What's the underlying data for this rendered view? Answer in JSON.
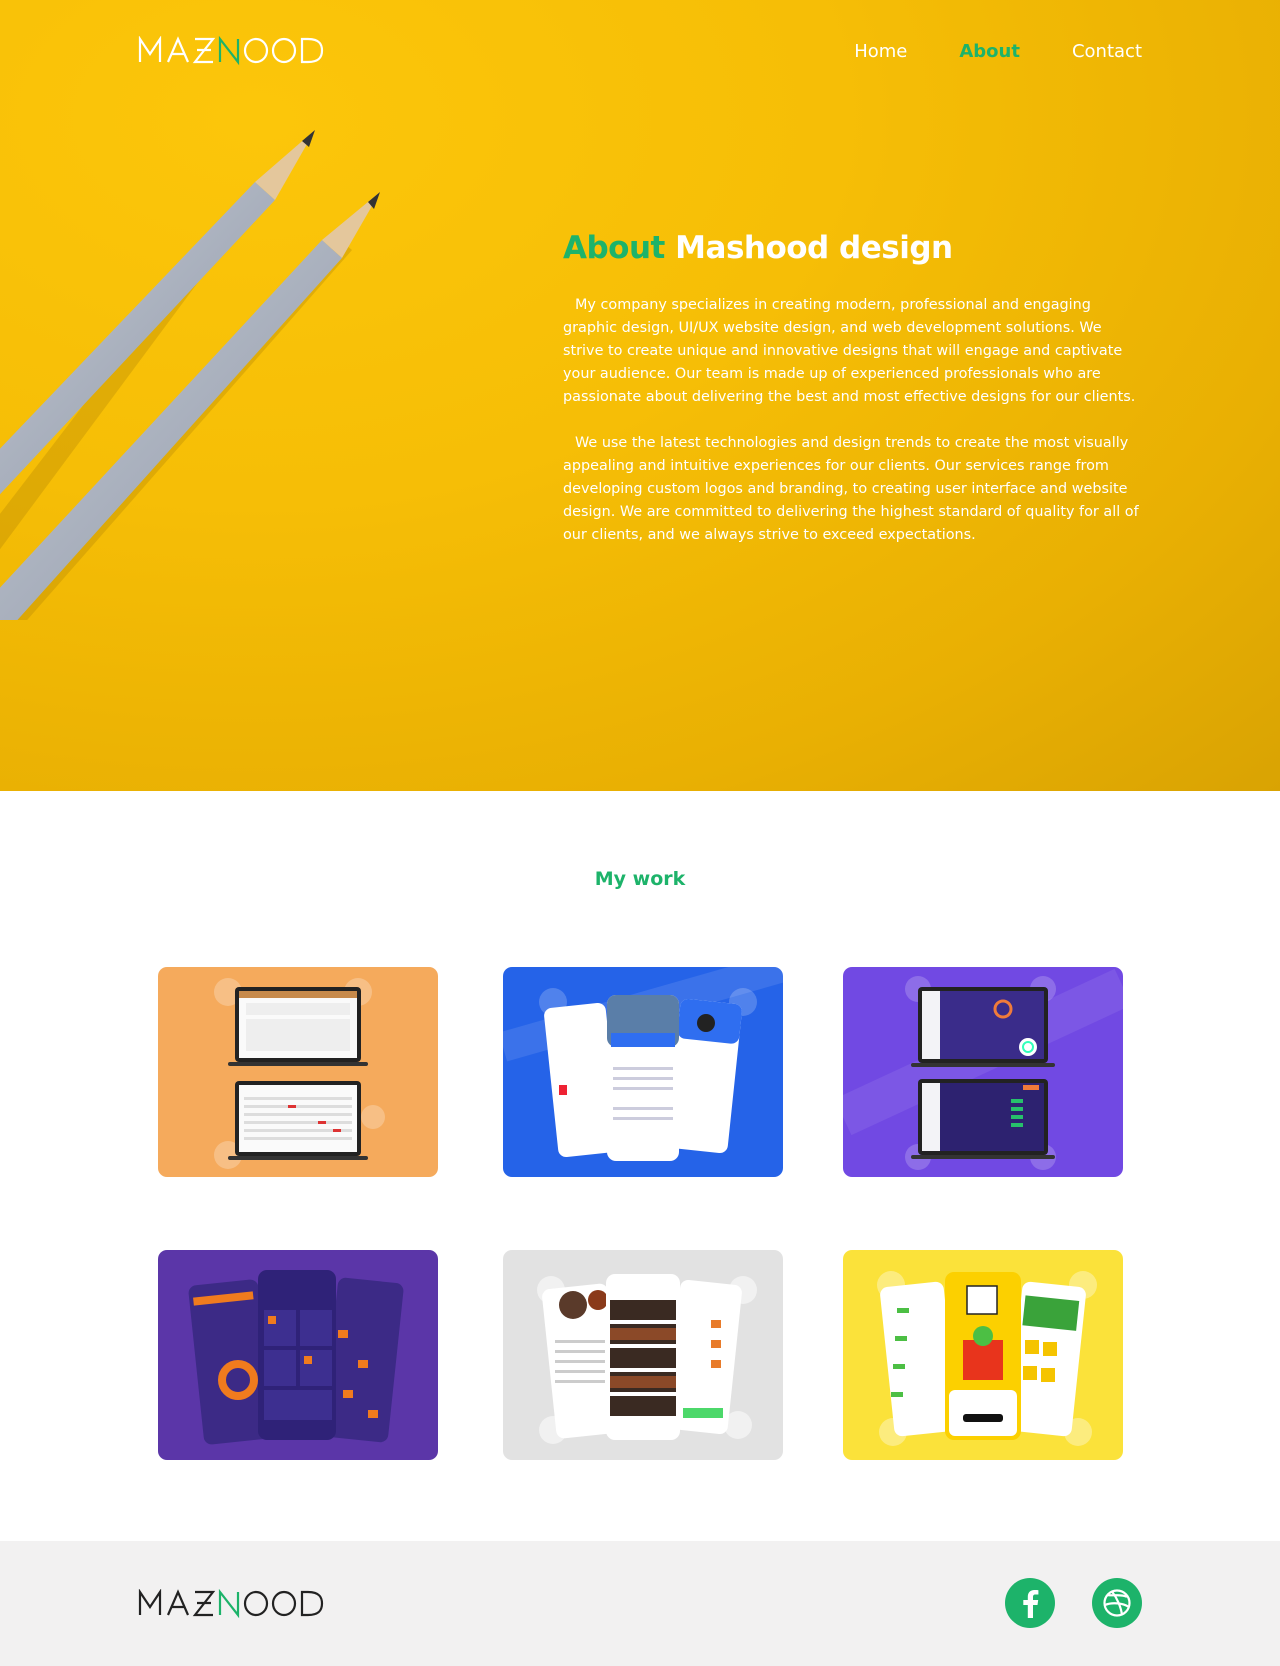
{
  "brand": {
    "logo_text": "MASHOOD",
    "accent": "#1db36a"
  },
  "nav": {
    "items": [
      {
        "label": "Home"
      },
      {
        "label": "About"
      },
      {
        "label": "Contact"
      }
    ]
  },
  "about": {
    "title_accent": "About",
    "title_rest": "Mashood design",
    "paragraphs": [
      "My company specializes in creating modern, professional and engaging graphic design, UI/UX website design, and web development solutions. We strive to create unique and innovative designs that will engage and captivate your audience. Our team is made up of experienced professionals who are passionate about delivering the best and most effective designs for our clients.",
      "We use the latest technologies and design trends to create the most visually appealing and intuitive experiences for our clients. Our services range from developing custom logos and branding, to creating user interface and website design. We are committed to delivering the highest standard of quality for all of our clients, and we always strive to exceed expectations."
    ]
  },
  "work": {
    "title": "My work",
    "cards": [
      {
        "bg": "#f5aa5c"
      },
      {
        "bg": "#2563e8"
      },
      {
        "bg": "#7149e3"
      },
      {
        "bg": "#5b36a8"
      },
      {
        "bg": "#e2e2e2"
      },
      {
        "bg": "#fbe23a"
      }
    ]
  },
  "footer": {
    "social": [
      {
        "icon": "facebook-icon"
      },
      {
        "icon": "dribbble-icon"
      }
    ]
  }
}
